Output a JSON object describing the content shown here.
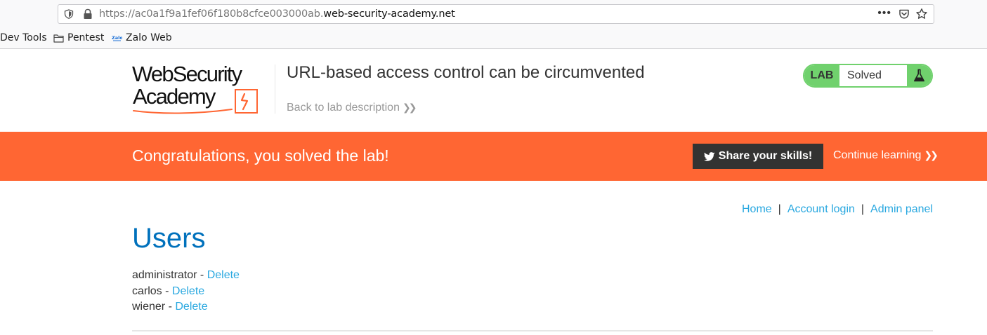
{
  "browser": {
    "url_prefix": "https://ac0a1f9a1fef06f180b8cfce003000ab.",
    "url_host": "web-security-academy.net",
    "more_label": "•••",
    "icons": [
      "shield-icon",
      "lock-icon",
      "pocket-icon",
      "star-icon"
    ],
    "bookmarks": [
      {
        "label": "Dev Tools",
        "icon": "none"
      },
      {
        "label": "Pentest",
        "icon": "folder-icon"
      },
      {
        "label": "Zalo Web",
        "icon": "zalo-icon"
      }
    ]
  },
  "header": {
    "logo_line1": "WebSecurity",
    "logo_line2": "Academy",
    "lab_title": "URL-based access control can be circumvented",
    "back_link": "Back to lab description",
    "status": {
      "lab_label": "LAB",
      "state": "Solved",
      "icon": "flask-icon"
    }
  },
  "banner": {
    "message": "Congratulations, you solved the lab!",
    "share_label": "Share your skills!",
    "continue_label": "Continue learning"
  },
  "nav": {
    "home": "Home",
    "separator": "|",
    "account_login": "Account login",
    "admin_panel": "Admin panel"
  },
  "main": {
    "title": "Users",
    "delete_label": "Delete",
    "dash": " - ",
    "users": [
      {
        "name": "administrator"
      },
      {
        "name": "carlos"
      },
      {
        "name": "wiener"
      }
    ]
  },
  "colors": {
    "accent_orange": "#ff6633",
    "status_green": "#70d16d",
    "link_blue": "#29a8e0",
    "heading_blue": "#0071bc"
  }
}
